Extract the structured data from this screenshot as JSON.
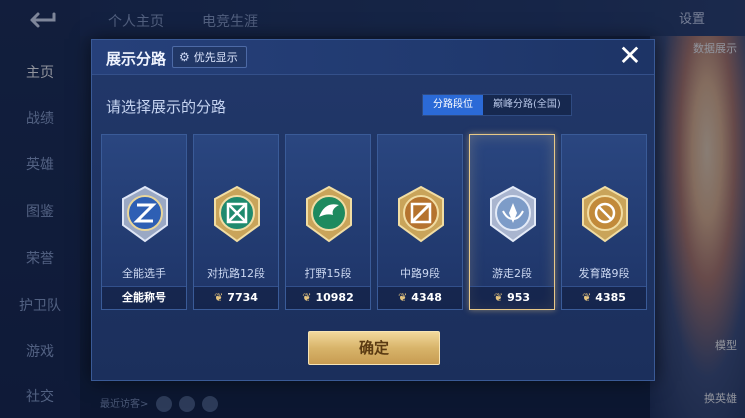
{
  "background": {
    "sidebar": [
      "主页",
      "战绩",
      "英雄",
      "图鉴",
      "荣誉",
      "护卫队",
      "游戏",
      "社交"
    ],
    "tabs": [
      "个人主页",
      "电竞生涯"
    ],
    "settings_label": "设置",
    "right_labels": [
      "数据展示",
      "模型",
      "换英雄"
    ],
    "recent_visitors": "最近访客>"
  },
  "dialog": {
    "title": "展示分路",
    "priority_label": "优先显示",
    "close_label": "✕",
    "subtitle": "请选择展示的分路",
    "segments": [
      {
        "label": "分路段位",
        "active": true
      },
      {
        "label": "巅峰分路(全国)",
        "active": false
      }
    ],
    "cards": [
      {
        "label": "全能选手",
        "foot": "全能称号",
        "points": false,
        "badge": "allround-badge-icon",
        "selected": false
      },
      {
        "label": "对抗路12段",
        "foot": "7734",
        "points": true,
        "badge": "clash-lane-badge-icon",
        "selected": false
      },
      {
        "label": "打野15段",
        "foot": "10982",
        "points": true,
        "badge": "jungle-badge-icon",
        "selected": false
      },
      {
        "label": "中路9段",
        "foot": "4348",
        "points": true,
        "badge": "mid-lane-badge-icon",
        "selected": false
      },
      {
        "label": "游走2段",
        "foot": "953",
        "points": true,
        "badge": "roam-badge-icon",
        "selected": true
      },
      {
        "label": "发育路9段",
        "foot": "4385",
        "points": true,
        "badge": "farm-lane-badge-icon",
        "selected": false
      }
    ],
    "confirm_label": "确定"
  },
  "colors": {
    "accent_blue": "#2b6ad7",
    "gold": "#d8b46a",
    "selected_border": "#e7c888"
  }
}
